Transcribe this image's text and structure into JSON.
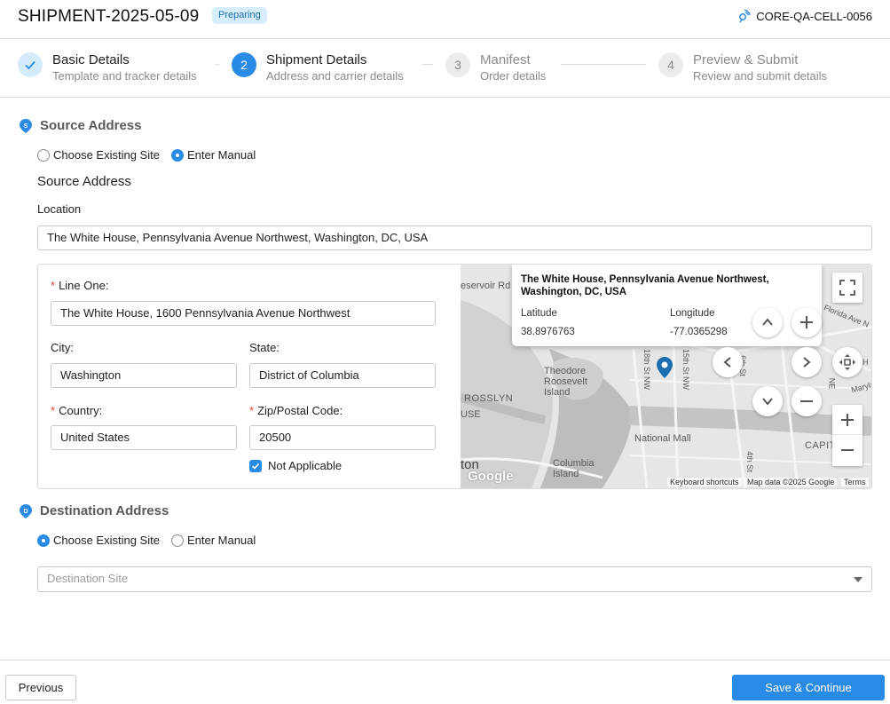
{
  "header": {
    "title": "SHIPMENT-2025-05-09",
    "status": "Preparing",
    "device": "CORE-QA-CELL-0056"
  },
  "steps": [
    {
      "number": "1",
      "title": "Basic Details",
      "subtitle": "Template and tracker details",
      "state": "done"
    },
    {
      "number": "2",
      "title": "Shipment Details",
      "subtitle": "Address and carrier details",
      "state": "active"
    },
    {
      "number": "3",
      "title": "Manifest",
      "subtitle": "Order details",
      "state": "pending"
    },
    {
      "number": "4",
      "title": "Preview & Submit",
      "subtitle": "Review and submit details",
      "state": "pending"
    }
  ],
  "source": {
    "heading": "Source Address",
    "pin_letter": "S",
    "option_existing": "Choose Existing Site",
    "option_manual": "Enter Manual",
    "selected": "manual",
    "subheading": "Source Address",
    "location_label": "Location",
    "location_value": "The White House, Pennsylvania Avenue Northwest, Washington, DC, USA",
    "line_one_label": "Line One:",
    "line_one_value": "The White House, 1600 Pennsylvania Avenue Northwest",
    "city_label": "City:",
    "city_value": "Washington",
    "state_label": "State:",
    "state_value": "District of Columbia",
    "country_label": "Country:",
    "country_value": "United States",
    "zip_label": "Zip/Postal Code:",
    "zip_value": "20500",
    "not_applicable_label": "Not Applicable",
    "not_applicable_checked": true
  },
  "map": {
    "info_title": "The White House, Pennsylvania Avenue Northwest, Washington, DC, USA",
    "latitude_label": "Latitude",
    "latitude_value": "38.8976763",
    "longitude_label": "Longitude",
    "longitude_value": "-77.0365298",
    "labels": {
      "reservoir": "eservoir Rd N",
      "theodore": "Theodore Roosevelt Island",
      "rosslyn": "ROSSLYN",
      "use": "USE",
      "ton": "ton",
      "columbia": "Columbia Island",
      "national_mall": "National Mall",
      "capitol": "CAPITOL",
      "florida": "Florida Ave N",
      "maryland": "Maryla",
      "h": "H",
      "ne": "NE",
      "st18": "18th St NW",
      "st15": "15th St NW",
      "st4": "4th St",
      "ne6": "6th St"
    },
    "google": "Google",
    "footer_shortcuts": "Keyboard shortcuts",
    "footer_data": "Map data ©2025 Google",
    "footer_terms": "Terms",
    "accent": "#2a8be6",
    "marker_color": "#1b6fb0"
  },
  "destination": {
    "heading": "Destination Address",
    "pin_letter": "D",
    "option_existing": "Choose Existing Site",
    "option_manual": "Enter Manual",
    "selected": "existing",
    "site_placeholder": "Destination Site"
  },
  "footer": {
    "previous": "Previous",
    "save": "Save & Continue"
  }
}
